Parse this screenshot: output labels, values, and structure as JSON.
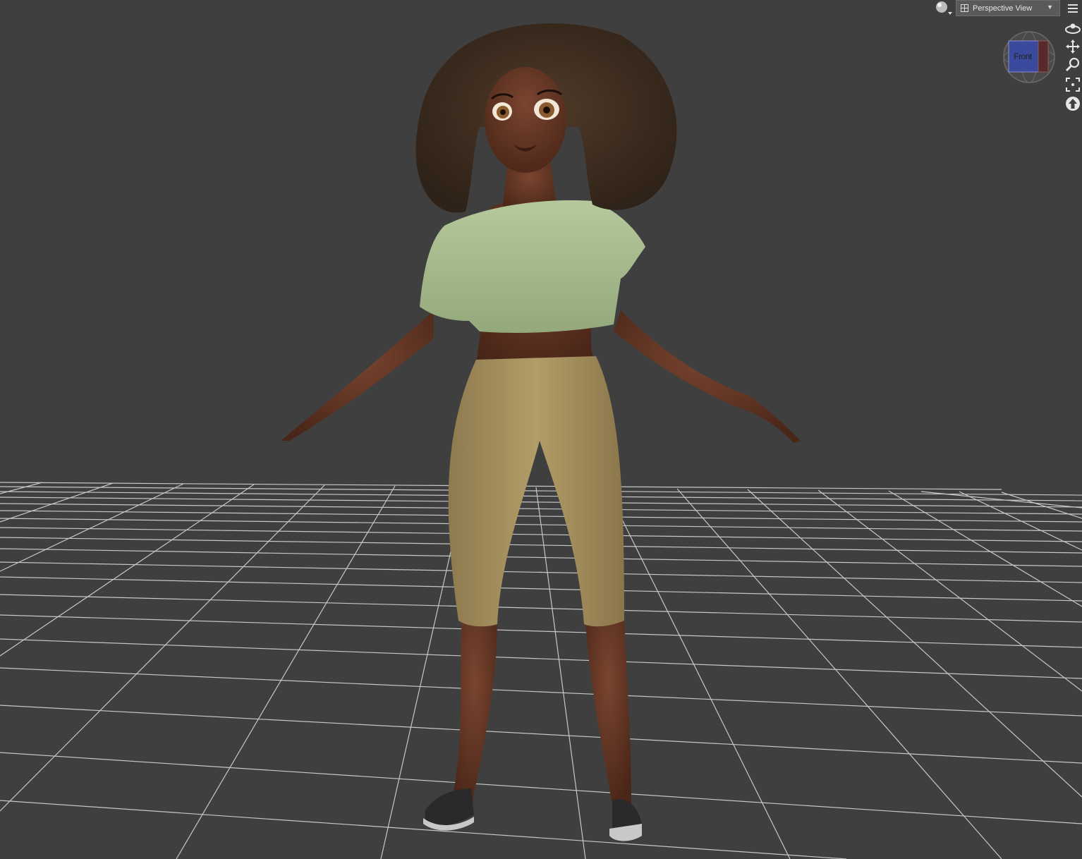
{
  "viewport": {
    "view_dropdown": {
      "label": "Perspective View",
      "icon": "grid-view-icon",
      "arrow_icon": "chevron-down-icon"
    },
    "render_style_icon": "sphere-render-icon",
    "menu_icon": "hamburger-menu-icon",
    "view_cube": {
      "face_label": "Front",
      "front_color": "#3c4a9e",
      "side_color": "#5a2a2a"
    },
    "camera_tools": [
      {
        "name": "orbit-tool",
        "icon": "orbit-icon"
      },
      {
        "name": "pan-tool",
        "icon": "move-arrows-icon"
      },
      {
        "name": "zoom-tool",
        "icon": "magnifier-icon"
      },
      {
        "name": "frame-tool",
        "icon": "frame-icon"
      },
      {
        "name": "reset-tool",
        "icon": "up-arrow-icon"
      }
    ],
    "scene": {
      "background_color": "#3f3f3f",
      "grid_color": "#d8d8d8",
      "figure": {
        "skin_color": "#5a3020",
        "top_color": "#a9bf90",
        "pants_color": "#a89260",
        "hair_color": "#3d2c1e",
        "shoe_color": "#2a2a2a"
      }
    }
  }
}
